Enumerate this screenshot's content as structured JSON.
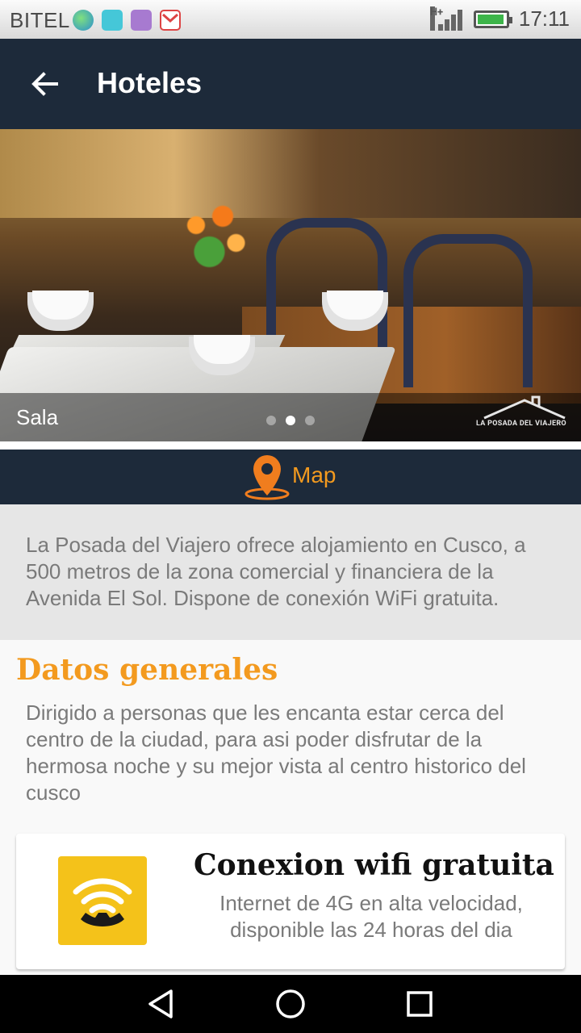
{
  "status_bar": {
    "carrier": "BITEL",
    "network_type": "H+",
    "time": "17:11",
    "notification_icons": [
      "globe-app-icon",
      "android-icon",
      "gallery-icon",
      "gmail-icon"
    ]
  },
  "app_bar": {
    "title": "Hoteles",
    "back_icon": "arrow-back-icon"
  },
  "gallery": {
    "caption": "Sala",
    "dots_total": 3,
    "active_dot": 1,
    "watermark": "LA POSADA DEL VIAJERO"
  },
  "map": {
    "label": "Map",
    "icon": "map-pin-icon",
    "accent_color": "#f39a1f"
  },
  "description": "La Posada del Viajero ofrece alojamiento en Cusco, a 500 metros de la zona comercial y financiera de la Avenida El Sol. Dispone de conexión WiFi gratuita.",
  "datos_generales": {
    "title": "Datos generales",
    "text": "Dirigido a personas que les encanta estar cerca del centro de la ciudad, para asi poder disfrutar de la hermosa noche y su mejor vista al centro historico del cusco"
  },
  "feature_card": {
    "title": "Conexion wifi gratuita",
    "subtitle": "Internet de 4G en alta velocidad, disponible las 24 horas del dia",
    "icon": "wifi-phone-icon"
  },
  "nav_bar": {
    "back": "nav-back-icon",
    "home": "nav-home-icon",
    "recents": "nav-recents-icon"
  },
  "colors": {
    "appbar_bg": "#1d2a3a",
    "accent": "#f39a1f",
    "card_icon_bg": "#f4c21a"
  }
}
